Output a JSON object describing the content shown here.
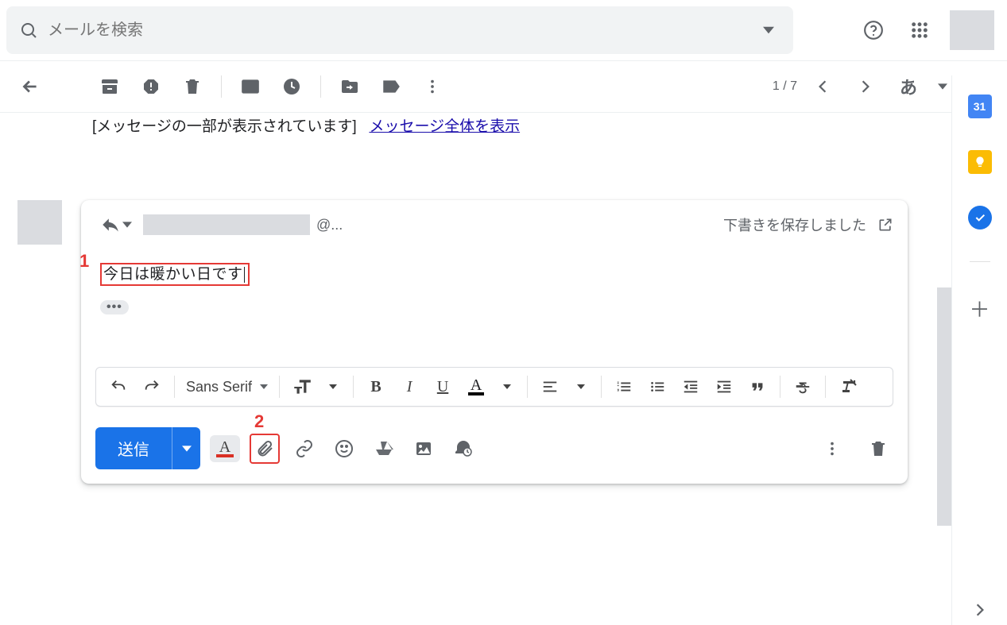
{
  "search": {
    "placeholder": "メールを検索"
  },
  "header": {},
  "toolbar": {
    "page_indicator": "1 / 7",
    "input_lang": "あ"
  },
  "message": {
    "trimmed_label": "[メッセージの一部が表示されています]",
    "view_full_link": "メッセージ全体を表示"
  },
  "compose": {
    "recipient_domain": "@...",
    "draft_saved": "下書きを保存しました",
    "body_text": "今日は暖かい日です",
    "trimmed_content_button": "•••",
    "font_family_label": "Sans Serif",
    "send_label": "送信"
  },
  "annotations": {
    "one": "1",
    "two": "2"
  },
  "colors": {
    "accent": "#1a73e8",
    "annotation": "#e53935",
    "text_color_bar": "#d93025",
    "calendar": "#4285f4",
    "keep": "#fbbc04",
    "tasks": "#1a73e8"
  }
}
